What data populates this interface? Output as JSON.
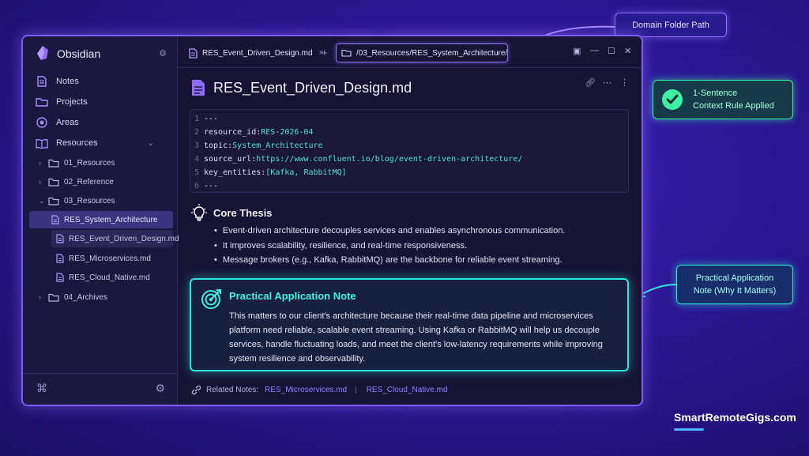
{
  "sidebar": {
    "app_name": "Obsidian",
    "nav": [
      {
        "label": "Notes",
        "icon": "document-icon"
      },
      {
        "label": "Projects",
        "icon": "folder-icon"
      },
      {
        "label": "Areas",
        "icon": "target-icon"
      },
      {
        "label": "Resources",
        "icon": "book-icon"
      }
    ],
    "tree": {
      "folders": [
        "01_Resources",
        "02_Reference",
        "03_Resources",
        "04_Archives"
      ],
      "files": [
        "RES_System_Architecture",
        "RES_Event_Driven_Design.md",
        "RES_Microservices.md",
        "RES_Cloud_Native.md"
      ]
    }
  },
  "tabs": {
    "active_tab": "RES_Event_Driven_Design.md",
    "path": "/03_Resources/RES_System_Architecture/"
  },
  "doc": {
    "title": "RES_Event_Driven_Design.md",
    "frontmatter": [
      {
        "ln": "1",
        "key": "---",
        "val": ""
      },
      {
        "ln": "2",
        "key": "resource_id: ",
        "val": "RES-2026-04"
      },
      {
        "ln": "3",
        "key": "topic: ",
        "val": "System_Architecture"
      },
      {
        "ln": "4",
        "key": "source_url: ",
        "val": "https://www.confluent.io/blog/event-driven-architecture/"
      },
      {
        "ln": "5",
        "key": "key_entities: ",
        "val": "[Kafka, RabbitMQ]"
      },
      {
        "ln": "6",
        "key": "---",
        "val": ""
      }
    ],
    "thesis_heading": "Core Thesis",
    "bullets": [
      "Event-driven architecture decouples services and enables asynchronous communication.",
      "It improves scalability, resilience, and real-time responsiveness.",
      "Message brokers (e.g., Kafka, RabbitMQ) are the backbone for reliable event streaming."
    ],
    "callout_title": "Practical Application Note",
    "callout_body": "This matters to our client's architecture because their real-time data pipeline and microservices platform need reliable, scalable event streaming. Using Kafka or RabbitMQ will help us decouple services, handle fluctuating loads, and meet the client's low-latency requirements while improving system resilience and observability.",
    "related_label": "Related Notes:",
    "related": [
      "RES_Microservices.md",
      "RES_Cloud_Native.md"
    ],
    "related_sep": "|"
  },
  "annotations": {
    "domain_path": "Domain Folder Path",
    "context_rule_line1": "1-Sentence",
    "context_rule_line2": "Context Rule Applied",
    "practical_line1": "Practical Application",
    "practical_line2": "Note (Why It Matters)"
  },
  "brand": "SmartRemoteGigs.com",
  "colors": {
    "accent_purple": "#8f70ff",
    "accent_teal": "#2ee6d9",
    "accent_green": "#3ef0a4",
    "background": "#2a1690"
  }
}
